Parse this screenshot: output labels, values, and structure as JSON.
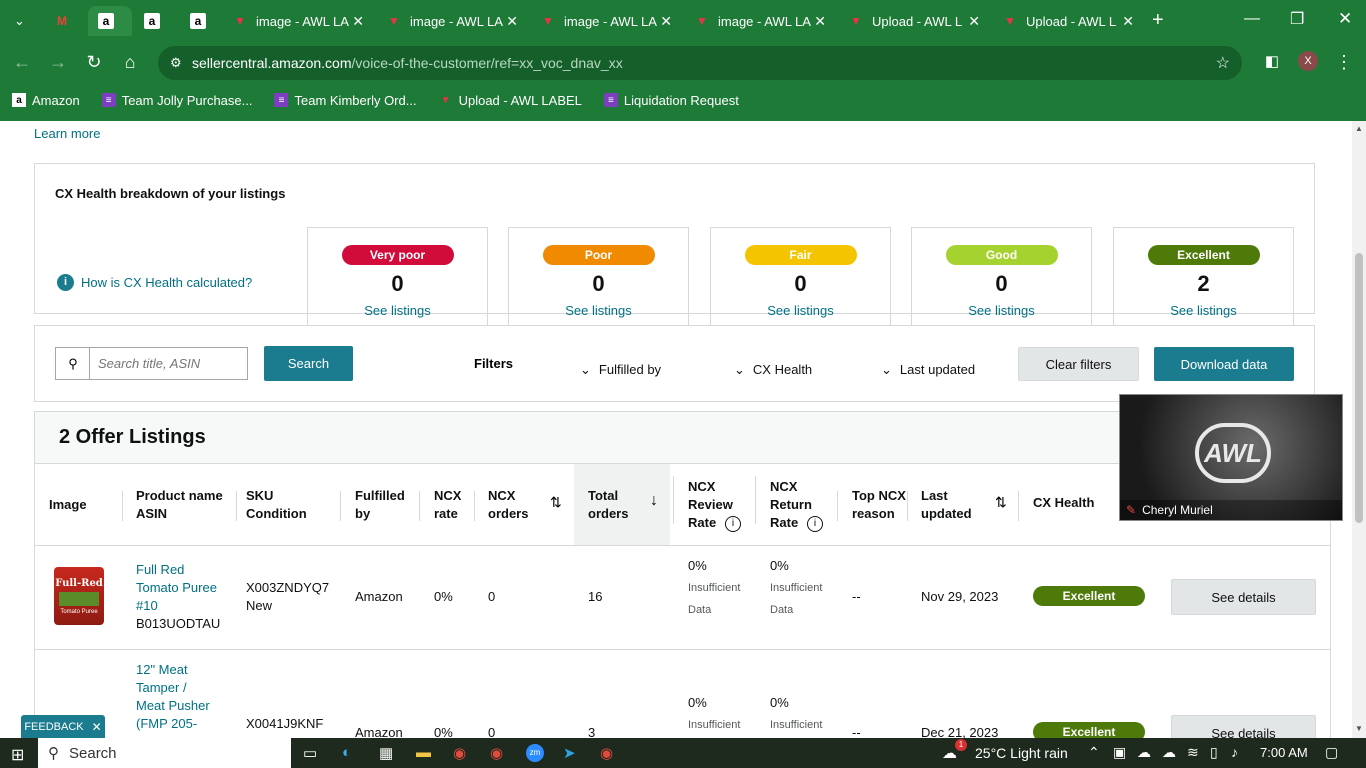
{
  "browser": {
    "tabs": [
      {
        "title": "",
        "icon": "gmail-icon"
      },
      {
        "title": "a",
        "icon": "amazon-icon"
      },
      {
        "title": "a",
        "icon": "amazon-icon"
      },
      {
        "title": "a",
        "icon": "amazon-icon"
      },
      {
        "title": "image - AWL LA"
      },
      {
        "title": "image - AWL LA"
      },
      {
        "title": "image - AWL LA"
      },
      {
        "title": "image - AWL LA"
      },
      {
        "title": "Upload - AWL L"
      },
      {
        "title": "Upload - AWL L"
      }
    ],
    "url_host": "sellercentral.amazon.com",
    "url_path": "/voice-of-the-customer/ref=xx_voc_dnav_xx",
    "profile_initial": "X",
    "bookmarks": [
      "Amazon",
      "Team Jolly Purchase...",
      "Team Kimberly Ord...",
      "Upload - AWL LABEL",
      "Liquidation Request"
    ]
  },
  "page": {
    "learn_more": "Learn more",
    "cx": {
      "title": "CX Health breakdown of your listings",
      "how_link": "How is CX Health calculated?",
      "categories": [
        {
          "label": "Very poor",
          "count": "0",
          "link": "See listings",
          "color": "#d10c3a",
          "text": "#ffffff"
        },
        {
          "label": "Poor",
          "count": "0",
          "link": "See listings",
          "color": "#f08a00",
          "text": "#ffffff"
        },
        {
          "label": "Fair",
          "count": "0",
          "link": "See listings",
          "color": "#f5c400",
          "text": "#ffffff"
        },
        {
          "label": "Good",
          "count": "0",
          "link": "See listings",
          "color": "#a5d22f",
          "text": "#ffffff"
        },
        {
          "label": "Excellent",
          "count": "2",
          "link": "See listings",
          "color": "#4e7a0a",
          "text": "#ffffff"
        }
      ]
    },
    "toolbar": {
      "search_placeholder": "Search title, ASIN",
      "search_button": "Search",
      "filters_label": "Filters",
      "filter_fulfilled": "Fulfilled by",
      "filter_cx": "CX Health",
      "filter_updated": "Last updated",
      "clear_filters": "Clear filters",
      "download": "Download data"
    },
    "listings": {
      "title": "2 Offer Listings",
      "headers": {
        "image": "Image",
        "product": "Product name",
        "asin": "ASIN",
        "sku": "SKU",
        "condition": "Condition",
        "fulfilled_1": "Fulfilled",
        "fulfilled_2": "by",
        "ncx_rate_1": "NCX",
        "ncx_rate_2": "rate",
        "ncx_orders_1": "NCX",
        "ncx_orders_2": "orders",
        "total_1": "Total",
        "total_2": "orders",
        "review_1": "NCX",
        "review_2": "Review",
        "review_3": "Rate",
        "return_1": "NCX",
        "return_2": "Return",
        "return_3": "Rate",
        "top_1": "Top NCX",
        "top_2": "reason",
        "updated_1": "Last",
        "updated_2": "updated",
        "cx_health": "CX Health"
      },
      "rows": [
        {
          "name_1": "Full Red",
          "name_2": "Tomato Puree",
          "name_3": "#10",
          "asin": "B013UODTAU",
          "sku": "X003ZNDYQ7",
          "condition": "New",
          "fulfilled": "Amazon",
          "ncx_rate": "0%",
          "ncx_orders": "0",
          "total": "16",
          "review_rate": "0%",
          "review_note_1": "Insufficient",
          "review_note_2": "Data",
          "return_rate": "0%",
          "return_note_1": "Insufficient",
          "return_note_2": "Data",
          "top_reason": "--",
          "updated": "Nov 29, 2023",
          "health": "Excellent",
          "action": "See details",
          "image_brand": "Full-Red",
          "image_label": "Tomato Puree"
        },
        {
          "name_1": "12\" Meat",
          "name_2": "Tamper /",
          "name_3": "Meat Pusher",
          "name_4": "(FMP 205-",
          "sku": "X0041J9KNF",
          "fulfilled": "Amazon",
          "ncx_rate": "0%",
          "ncx_orders": "0",
          "total": "3",
          "review_rate": "0%",
          "review_note_1": "Insufficient",
          "return_rate": "0%",
          "return_note_1": "Insufficient",
          "top_reason": "--",
          "updated": "Dec 21, 2023",
          "health": "Excellent",
          "action": "See details"
        }
      ]
    },
    "video_name": "Cheryl Muriel",
    "video_logo": "AWL",
    "feedback": "FEEDBACK"
  },
  "taskbar": {
    "search": "Search",
    "weather": "25°C  Light rain",
    "time": "7:00 AM",
    "notification_count": "1"
  }
}
